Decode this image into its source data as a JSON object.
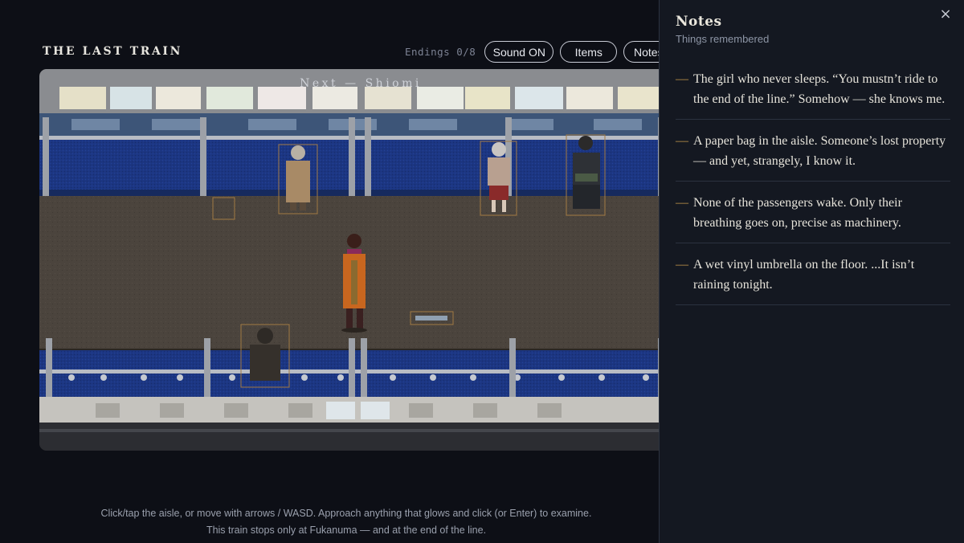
{
  "header": {
    "title": "THE LAST TRAIN",
    "endings": "Endings 0/8",
    "buttons": {
      "sound": "Sound ON",
      "items": "Items",
      "notes": "Notes"
    }
  },
  "scene": {
    "next_station": "Next — Shiomi",
    "colors": {
      "seat_blue": "#1c3a8a",
      "floor": "#4a433c",
      "player_coat": "#c8661f",
      "highlight": "#b98a4e"
    }
  },
  "hint": {
    "line1": "Click/tap the aisle, or move with arrows / WASD. Approach anything that glows and click (or Enter) to examine.",
    "line2": "This train stops only at Fukanuma — and at the end of the line."
  },
  "notes_panel": {
    "title": "Notes",
    "subtitle": "Things remembered",
    "close_icon": "close-icon",
    "items": [
      {
        "text": "The girl who never sleeps. “You mustn’t ride to the end of the line.” Somehow — she knows me."
      },
      {
        "text": "A paper bag in the aisle. Someone’s lost property — and yet, strangely, I know it."
      },
      {
        "text": "None of the passengers wake. Only their breathing goes on, precise as machinery."
      },
      {
        "text": "A wet vinyl umbrella on the floor. ...It isn’t raining tonight."
      }
    ]
  }
}
